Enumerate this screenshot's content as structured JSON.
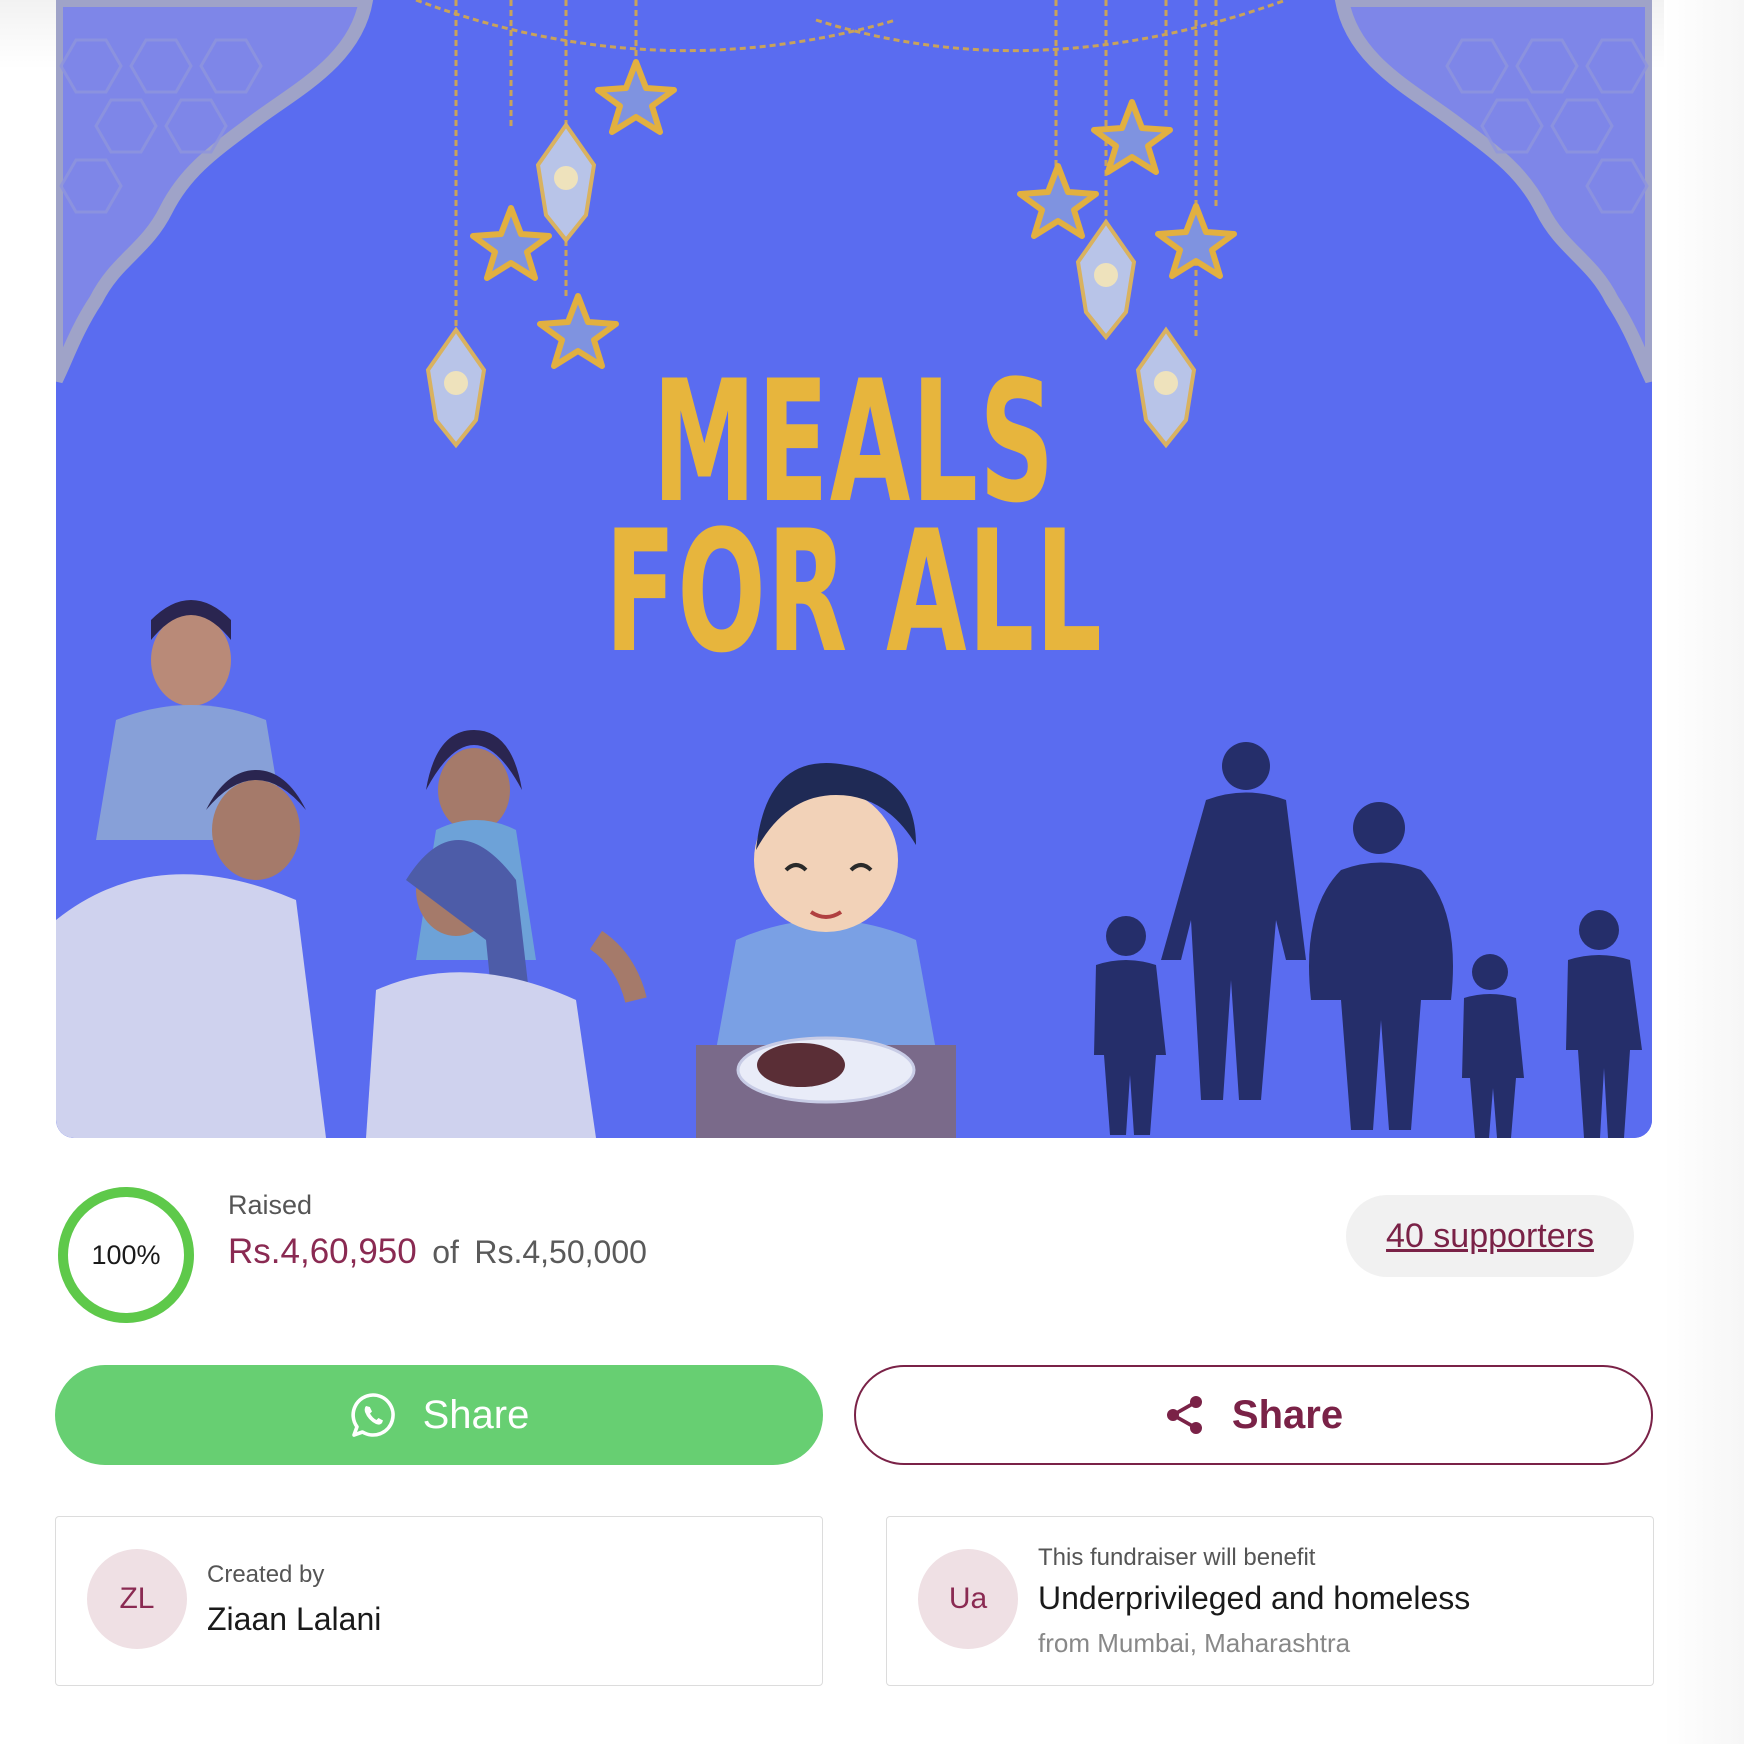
{
  "banner": {
    "title_line1": "MEALS",
    "title_line2": "FOR ALL",
    "background_color": "#5a6cf0",
    "title_color": "#e7b53d"
  },
  "progress": {
    "percent_label": "100%",
    "percent_value": 100,
    "ring_color": "#5ec94a",
    "raised_label": "Raised",
    "raised_amount": "Rs.4,60,950",
    "of_text": "of",
    "goal_amount": "Rs.4,50,000"
  },
  "supporters": {
    "label": "40 supporters"
  },
  "buttons": {
    "whatsapp_share": {
      "label": "Share",
      "icon": "whatsapp-icon",
      "color": "#67cf72"
    },
    "share": {
      "label": "Share",
      "icon": "share-icon",
      "color": "#7a2247"
    }
  },
  "creator_card": {
    "avatar_initials": "ZL",
    "caption": "Created by",
    "name": "Ziaan Lalani"
  },
  "beneficiary_card": {
    "avatar_initials": "Ua",
    "caption": "This fundraiser will benefit",
    "name": "Underprivileged and homeless",
    "location": "from Mumbai, Maharashtra"
  },
  "colors": {
    "brand": "#7a2247",
    "amount": "#8a2a52",
    "accent_strip": "#c23a52"
  }
}
